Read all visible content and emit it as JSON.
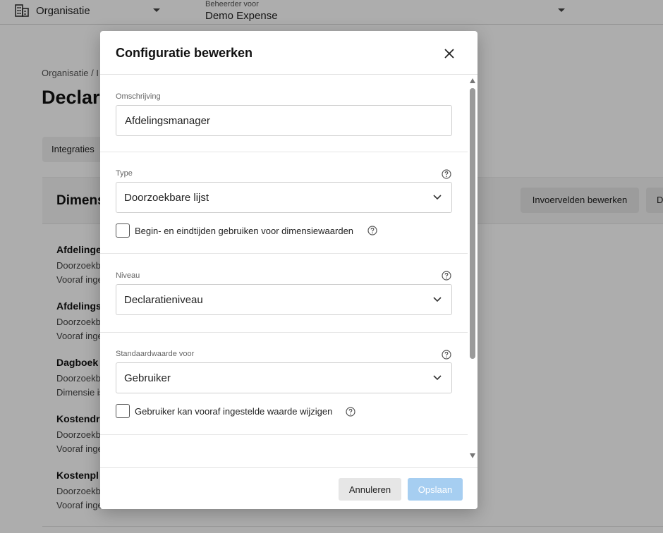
{
  "topbar": {
    "org_label": "Organisatie",
    "admin_small": "Beheerder voor",
    "admin_name": "Demo Expense"
  },
  "page": {
    "breadcrumb": "Organisatie / I",
    "title": "Declara",
    "tab_integraties": "Integraties"
  },
  "card": {
    "title": "Dimens",
    "btn_invoervelden": "Invoervelden bewerken",
    "btn_d": "D",
    "items": [
      {
        "name": "Afdelinge",
        "line1": "Doorzoekb",
        "line2": "Vooraf inge"
      },
      {
        "name": "Afdelings",
        "line1": "Doorzoekb",
        "line2": "Vooraf inge"
      },
      {
        "name": "Dagboek",
        "line1": "Doorzoekb",
        "line2": "Dimensie is"
      },
      {
        "name": "Kostendr",
        "line1": "Doorzoekb",
        "line2": "Vooraf inge"
      },
      {
        "name": "Kostenpl",
        "line1": "Doorzoekb",
        "line2": "Vooraf inge"
      }
    ]
  },
  "modal": {
    "title": "Configuratie bewerken",
    "omschrijving": {
      "label": "Omschrijving",
      "value": "Afdelingsmanager"
    },
    "type": {
      "label": "Type",
      "value": "Doorzoekbare lijst"
    },
    "begin_eind": {
      "label": "Begin- en eindtijden gebruiken voor dimensiewaarden",
      "checked": false
    },
    "niveau": {
      "label": "Niveau",
      "value": "Declaratieniveau"
    },
    "standaardwaarde": {
      "label": "Standaardwaarde voor",
      "value": "Gebruiker"
    },
    "wijzigen": {
      "label": "Gebruiker kan vooraf ingestelde waarde wijzigen",
      "checked": false
    },
    "btn_cancel": "Annuleren",
    "btn_save": "Opslaan"
  },
  "colors": {
    "save_button": "#a6cef1",
    "overlay": "rgba(0,0,0,0.32)"
  }
}
